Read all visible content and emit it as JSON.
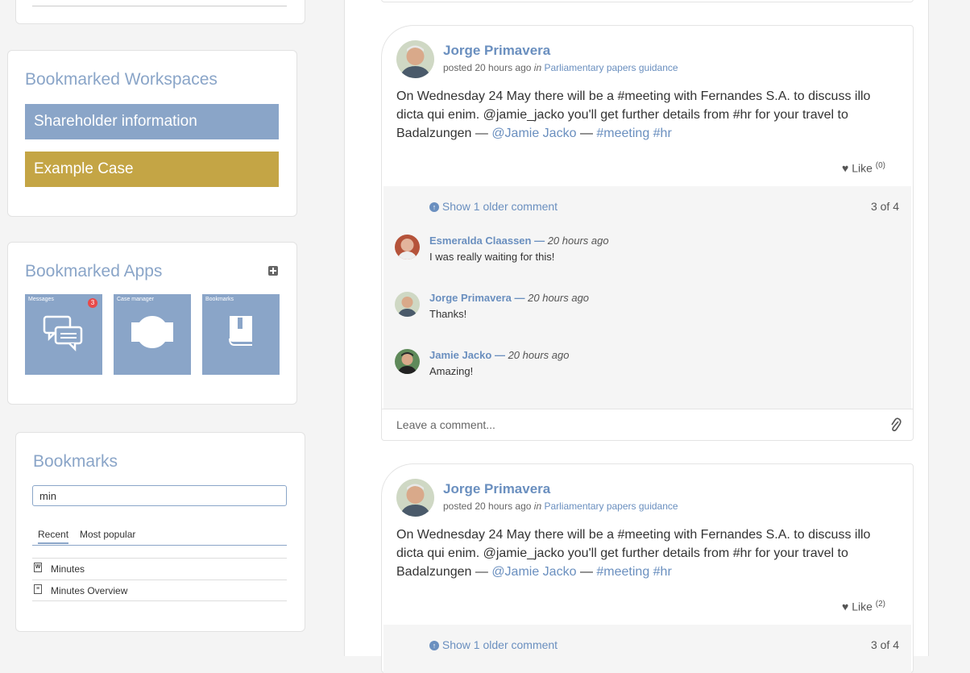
{
  "sidebar": {
    "workspaces": {
      "title": "Bookmarked Workspaces",
      "items": [
        {
          "label": "Shareholder information",
          "color": "#8aa5c8"
        },
        {
          "label": "Example Case",
          "color": "#c4a545"
        }
      ]
    },
    "apps": {
      "title": "Bookmarked Apps",
      "add_icon": "plus-square-icon",
      "tiles": [
        {
          "label": "Messages",
          "badge": "3",
          "icon": "chat-bubbles-icon"
        },
        {
          "label": "Case manager",
          "icon": "case-icon"
        },
        {
          "label": "Bookmarks",
          "icon": "book-icon"
        }
      ]
    },
    "bookmarks": {
      "title": "Bookmarks",
      "search_value": "min",
      "tabs": [
        "Recent",
        "Most popular"
      ],
      "active_tab": "Recent",
      "items": [
        {
          "label": "Minutes",
          "icon": "word-doc-icon"
        },
        {
          "label": "Minutes Overview",
          "icon": "document-icon"
        }
      ]
    }
  },
  "posts": [
    {
      "author": "Jorge Primavera",
      "posted": "posted",
      "time": "20 hours ago",
      "in": "in",
      "workspace": "Parliamentary papers guidance",
      "text_prefix": "On Wednesday 24 May there will be a #meeting with Fernandes S.A. to discuss illo dicta qui enim. @jamie_jacko you'll get further details from #hr for your travel to Badalzungen —",
      "mention": "@Jamie Jacko",
      "dash": "—",
      "tags": "#meeting #hr",
      "like_label": "Like",
      "like_count": "(0)",
      "show_older": "Show 1 older comment",
      "comment_count": "3 of 4",
      "comments": [
        {
          "author": "Esmeralda Claassen —",
          "time": "20 hours ago",
          "text": "I was really waiting for this!"
        },
        {
          "author": "Jorge Primavera —",
          "time": "20 hours ago",
          "text": "Thanks!"
        },
        {
          "author": "Jamie Jacko —",
          "time": "20 hours ago",
          "text": "Amazing!"
        }
      ],
      "comment_placeholder": "Leave a comment..."
    },
    {
      "author": "Jorge Primavera",
      "posted": "posted",
      "time": "20 hours ago",
      "in": "in",
      "workspace": "Parliamentary papers guidance",
      "text_prefix": "On Wednesday 24 May there will be a #meeting with Fernandes S.A. to discuss illo dicta qui enim. @jamie_jacko you'll get further details from #hr for your travel to Badalzungen —",
      "mention": "@Jamie Jacko",
      "dash": "—",
      "tags": "#meeting #hr",
      "like_label": "Like",
      "like_count": "(2)",
      "show_older": "Show 1 older comment",
      "comment_count": "3 of 4"
    }
  ],
  "colors": {
    "accent": "#6a8fbf",
    "tile": "#8aa5c8",
    "case": "#c4a545",
    "badge": "#e84a4a"
  }
}
